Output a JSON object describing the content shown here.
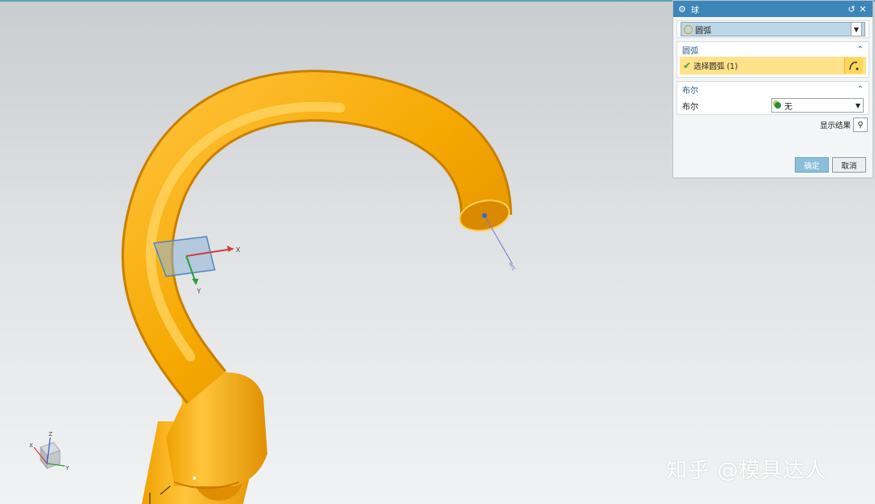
{
  "dialog": {
    "title": "球",
    "type_value": "圆弧",
    "arc_section": {
      "heading": "圆弧",
      "select_label": "选择圆弧 (1)"
    },
    "boolean_section": {
      "heading": "布尔",
      "label": "布尔",
      "value": "无"
    },
    "preview_label": "显示结果",
    "ok_label": "确定",
    "cancel_label": "取消"
  },
  "viewport": {
    "axis_x": "X",
    "axis_y": "Y",
    "triad_x": "X",
    "triad_y": "Y",
    "triad_z": "Z"
  },
  "watermark": "知乎 @模具达人",
  "colors": {
    "model": "#f5a800",
    "accent": "#3c86b8",
    "selection": "#ffe28a"
  }
}
